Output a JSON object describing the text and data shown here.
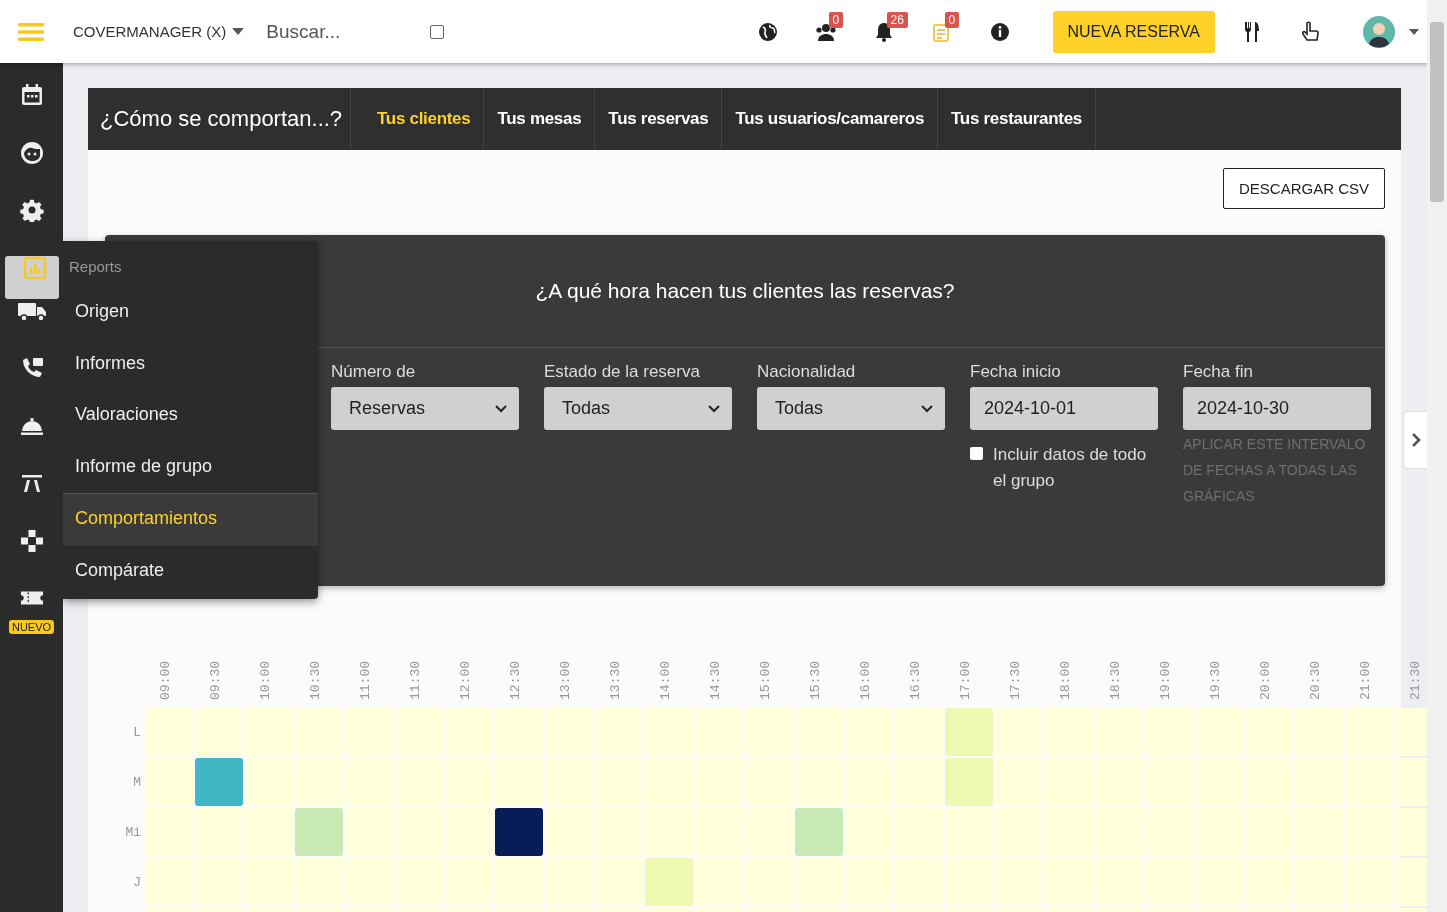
{
  "topbar": {
    "brand": "COVERMANAGER (X)",
    "search": {
      "placeholder": "Buscar..."
    },
    "toggle": {
      "checked": false
    },
    "icons": [
      {
        "kind": "globe"
      },
      {
        "kind": "users",
        "badge": "0"
      },
      {
        "kind": "bell",
        "badge": "26"
      },
      {
        "kind": "notes",
        "badge": "0"
      },
      {
        "kind": "info"
      }
    ],
    "new_button": "NUEVA RESERVA"
  },
  "sidebar": {
    "items": [
      {
        "kind": "calendar",
        "selected": false
      },
      {
        "kind": "face",
        "selected": false
      },
      {
        "kind": "gear",
        "selected": false
      },
      {
        "kind": "chart",
        "selected": true
      },
      {
        "kind": "truck",
        "selected": false
      },
      {
        "kind": "phone",
        "selected": false
      },
      {
        "kind": "cloche",
        "selected": false
      },
      {
        "kind": "table",
        "selected": false
      },
      {
        "kind": "puzzle",
        "selected": false
      },
      {
        "kind": "ticket",
        "selected": false,
        "badge": "NUEVO"
      }
    ]
  },
  "menu": {
    "title": "Reports",
    "items": [
      {
        "label": "Origen",
        "selected": false
      },
      {
        "label": "Informes",
        "selected": false
      },
      {
        "label": "Valoraciones",
        "selected": false
      },
      {
        "label": "Informe de grupo",
        "selected": false
      },
      {
        "label": "Comportamientos",
        "selected": true
      },
      {
        "label": "Compárate",
        "selected": false
      }
    ]
  },
  "header": {
    "title": "¿Cómo se comportan...?",
    "tabs": [
      {
        "label": "Tus clientes",
        "selected": true
      },
      {
        "label": "Tus mesas",
        "selected": false
      },
      {
        "label": "Tus reservas",
        "selected": false
      },
      {
        "label": "Tus usuarios/camareros",
        "selected": false
      },
      {
        "label": "Tus restaurantes",
        "selected": false
      }
    ]
  },
  "download_button": "DESCARGAR CSV",
  "panel": {
    "title": "¿A qué hora hacen tus clientes las reservas?",
    "filters": [
      {
        "kind": "select",
        "label": "Número de",
        "value": "Reservas"
      },
      {
        "kind": "select",
        "label": "Estado de la reserva",
        "value": "Todas"
      },
      {
        "kind": "select",
        "label": "Nacionalidad",
        "value": "Todas"
      },
      {
        "kind": "date",
        "label": "Fecha inicio",
        "value": "2024-10-01",
        "checkbox": {
          "label": "Incluir datos de todo el grupo",
          "checked": false
        }
      },
      {
        "kind": "date",
        "label": "Fecha fin",
        "value": "2024-10-30",
        "link": "APLICAR ESTE INTERVALO DE FECHAS A TODAS LAS GRÁFICAS"
      }
    ]
  },
  "heatmap": {
    "columns": [
      "09:00",
      "09:30",
      "10:00",
      "10:30",
      "11:00",
      "11:30",
      "12:00",
      "12:30",
      "13:00",
      "13:30",
      "14:00",
      "14:30",
      "15:00",
      "15:30",
      "16:00",
      "16:30",
      "17:00",
      "17:30",
      "18:00",
      "18:30",
      "19:00",
      "19:30",
      "20:00",
      "20:30",
      "21:00",
      "21:30"
    ],
    "rows": [
      {
        "label": "L",
        "cells": [
          {
            "color": "#ffffd9"
          },
          {
            "color": "#ffffd9"
          },
          {
            "color": "#ffffd9"
          },
          {
            "color": "#ffffd9"
          },
          {
            "color": "#ffffd9"
          },
          {
            "color": "#ffffd9"
          },
          {
            "color": "#ffffd9"
          },
          {
            "color": "#ffffd9"
          },
          {
            "color": "#ffffd9"
          },
          {
            "color": "#ffffd9"
          },
          {
            "color": "#ffffd9"
          },
          {
            "color": "#ffffd9"
          },
          {
            "color": "#ffffd9"
          },
          {
            "color": "#ffffd9"
          },
          {
            "color": "#ffffd9"
          },
          {
            "color": "#ffffd9"
          },
          {
            "color": "#edf8b1"
          },
          {
            "color": "#ffffd9"
          },
          {
            "color": "#ffffd9"
          },
          {
            "color": "#ffffd9"
          },
          {
            "color": "#ffffd9"
          },
          {
            "color": "#ffffd9"
          },
          {
            "color": "#ffffd9"
          },
          {
            "color": "#ffffd9"
          },
          {
            "color": "#ffffd9"
          },
          {
            "color": "#ffffd9"
          }
        ]
      },
      {
        "label": "M",
        "cells": [
          {
            "color": "#ffffd9"
          },
          {
            "color": "#41b6c4"
          },
          {
            "color": "#ffffd9"
          },
          {
            "color": "#ffffd9"
          },
          {
            "color": "#ffffd9"
          },
          {
            "color": "#ffffd9"
          },
          {
            "color": "#ffffd9"
          },
          {
            "color": "#ffffd9"
          },
          {
            "color": "#ffffd9"
          },
          {
            "color": "#ffffd9"
          },
          {
            "color": "#ffffd9"
          },
          {
            "color": "#ffffd9"
          },
          {
            "color": "#ffffd9"
          },
          {
            "color": "#ffffd9"
          },
          {
            "color": "#ffffd9"
          },
          {
            "color": "#ffffd9"
          },
          {
            "color": "#edf8b1"
          },
          {
            "color": "#ffffd9"
          },
          {
            "color": "#ffffd9"
          },
          {
            "color": "#ffffd9"
          },
          {
            "color": "#ffffd9"
          },
          {
            "color": "#ffffd9"
          },
          {
            "color": "#ffffd9"
          },
          {
            "color": "#ffffd9"
          },
          {
            "color": "#ffffd9"
          },
          {
            "color": "#ffffd9"
          }
        ]
      },
      {
        "label": "Mi",
        "cells": [
          {
            "color": "#ffffd9"
          },
          {
            "color": "#ffffd9"
          },
          {
            "color": "#ffffd9"
          },
          {
            "color": "#c7e9b4"
          },
          {
            "color": "#ffffd9"
          },
          {
            "color": "#ffffd9"
          },
          {
            "color": "#ffffd9"
          },
          {
            "color": "#081d58"
          },
          {
            "color": "#ffffd9"
          },
          {
            "color": "#ffffd9"
          },
          {
            "color": "#ffffd9"
          },
          {
            "color": "#ffffd9"
          },
          {
            "color": "#ffffd9"
          },
          {
            "color": "#c7e9b4"
          },
          {
            "color": "#ffffd9"
          },
          {
            "color": "#ffffd9"
          },
          {
            "color": "#ffffd9"
          },
          {
            "color": "#ffffd9"
          },
          {
            "color": "#ffffd9"
          },
          {
            "color": "#ffffd9"
          },
          {
            "color": "#ffffd9"
          },
          {
            "color": "#ffffd9"
          },
          {
            "color": "#ffffd9"
          },
          {
            "color": "#ffffd9"
          },
          {
            "color": "#ffffd9"
          },
          {
            "color": "#ffffd9"
          }
        ]
      },
      {
        "label": "J",
        "cells": [
          {
            "color": "#ffffd9"
          },
          {
            "color": "#ffffd9"
          },
          {
            "color": "#ffffd9"
          },
          {
            "color": "#ffffd9"
          },
          {
            "color": "#ffffd9"
          },
          {
            "color": "#ffffd9"
          },
          {
            "color": "#ffffd9"
          },
          {
            "color": "#ffffd9"
          },
          {
            "color": "#ffffd9"
          },
          {
            "color": "#ffffd9"
          },
          {
            "color": "#edf8b1"
          },
          {
            "color": "#ffffd9"
          },
          {
            "color": "#ffffd9"
          },
          {
            "color": "#ffffd9"
          },
          {
            "color": "#ffffd9"
          },
          {
            "color": "#ffffd9"
          },
          {
            "color": "#ffffd9"
          },
          {
            "color": "#ffffd9"
          },
          {
            "color": "#ffffd9"
          },
          {
            "color": "#ffffd9"
          },
          {
            "color": "#ffffd9"
          },
          {
            "color": "#ffffd9"
          },
          {
            "color": "#ffffd9"
          },
          {
            "color": "#ffffd9"
          },
          {
            "color": "#ffffd9"
          },
          {
            "color": "#ffffd9"
          }
        ]
      },
      {
        "cells": [
          {
            "color": "#ffffd9"
          },
          {
            "color": "#ffffd9"
          },
          {
            "color": "#ffffd9"
          },
          {
            "color": "#ffffd9"
          },
          {
            "color": "#ffffd9"
          },
          {
            "color": "#ffffd9"
          },
          {
            "color": "#ffffd9"
          },
          {
            "color": "#ffffd9"
          },
          {
            "color": "#ffffd9"
          },
          {
            "color": "#ffffd9"
          },
          {
            "color": "#ffffd9"
          },
          {
            "color": "#ffffd9"
          },
          {
            "color": "#ffffd9"
          },
          {
            "color": "#ffffd9"
          },
          {
            "color": "#ffffd9"
          },
          {
            "color": "#ffffd9"
          },
          {
            "color": "#ffffd9"
          },
          {
            "color": "#ffffd9"
          },
          {
            "color": "#ffffd9"
          },
          {
            "color": "#ffffd9"
          },
          {
            "color": "#ffffd9"
          },
          {
            "color": "#ffffd9"
          },
          {
            "color": "#ffffd9"
          },
          {
            "color": "#ffffd9"
          },
          {
            "color": "#ffffd9"
          },
          {
            "color": "#ffffd9"
          }
        ]
      }
    ]
  }
}
